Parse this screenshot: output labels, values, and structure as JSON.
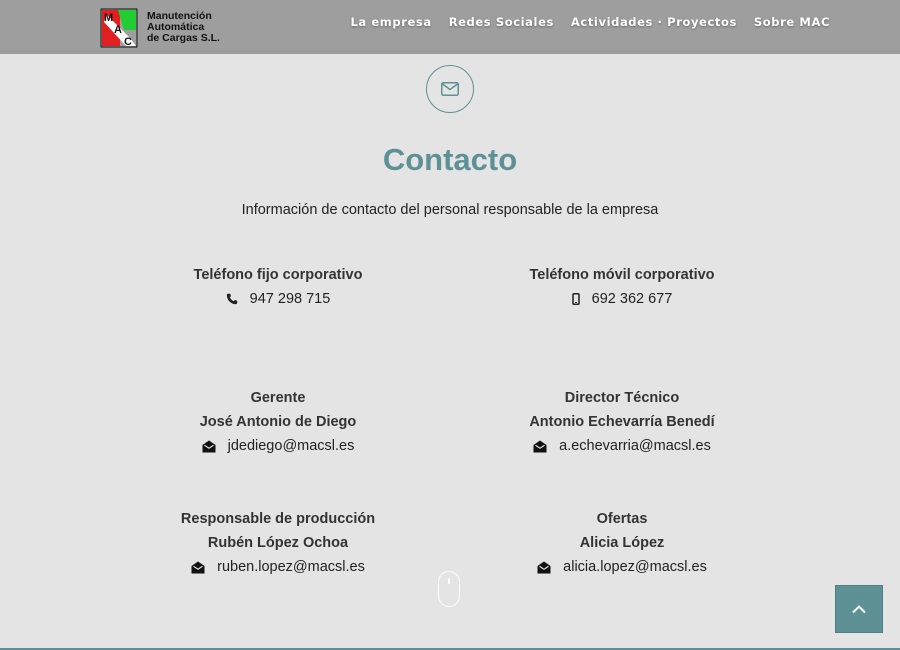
{
  "logo": {
    "letters": [
      "M",
      "A",
      "C"
    ],
    "lines": [
      "Manutención",
      "Automática",
      "de Cargas S.L."
    ]
  },
  "nav": {
    "items": [
      "La empresa",
      "Redes Sociales",
      "Actividades · Proyectos",
      "Sobre MAC"
    ]
  },
  "section": {
    "icon": "envelope-icon",
    "title": "Contacto",
    "subtitle": "Información de contacto del personal responsable de la empresa"
  },
  "phones": [
    {
      "label": "Teléfono fijo corporativo",
      "icon": "phone-icon",
      "number": "947 298 715"
    },
    {
      "label": "Teléfono móvil corporativo",
      "icon": "mobile-icon",
      "number": "692 362 677"
    }
  ],
  "contacts": [
    {
      "role": "Gerente",
      "name": "José Antonio de Diego",
      "icon": "envelope-open-icon",
      "email": "jdediego@macsl.es"
    },
    {
      "role": "Director Técnico",
      "name": "Antonio Echevarría Benedí",
      "icon": "envelope-open-icon",
      "email": "a.echevarria@macsl.es"
    },
    {
      "role": "Responsable de producción",
      "name": "Rubén López Ochoa",
      "icon": "envelope-open-icon",
      "email": "ruben.lopez@macsl.es"
    },
    {
      "role": "Ofertas",
      "name": "Alicia López",
      "icon": "envelope-open-icon",
      "email": "alicia.lopez@macsl.es"
    }
  ],
  "colors": {
    "accent": "#5d9195",
    "topbar": "#9e9e9e",
    "background": "#e4e4e4"
  }
}
